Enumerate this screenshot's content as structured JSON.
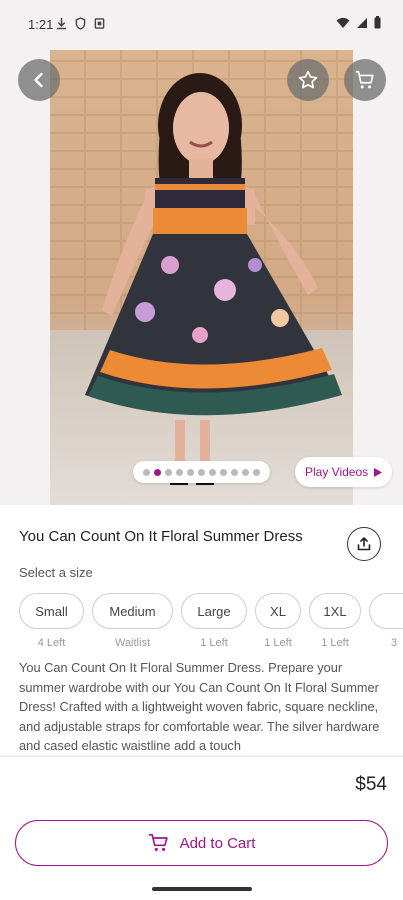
{
  "status_bar": {
    "time": "1:21"
  },
  "product": {
    "title": "You Can Count On It Floral Summer Dress",
    "select_size_label": "Select a size",
    "sizes": [
      {
        "label": "Small",
        "availability": "4 Left"
      },
      {
        "label": "Medium",
        "availability": "Waitlist"
      },
      {
        "label": "Large",
        "availability": "1 Left"
      },
      {
        "label": "XL",
        "availability": "1 Left"
      },
      {
        "label": "1XL",
        "availability": "1 Left"
      },
      {
        "label": "",
        "availability": "3"
      }
    ],
    "description": "You Can Count On It Floral Summer Dress. Prepare your summer wardrobe with our You Can Count On It Floral Summer Dress! Crafted with a lightweight woven fabric, square neckline, and adjustable straps for comfortable wear. The silver hardware and cased elastic waistline add a touch",
    "price": "$54"
  },
  "gallery": {
    "image_count": 11,
    "active_index": 1,
    "play_videos_label": "Play Videos"
  },
  "actions": {
    "add_to_cart_label": "Add to Cart"
  },
  "colors": {
    "accent": "#a0148c"
  },
  "icons": [
    "back-arrow-icon",
    "star-icon",
    "cart-icon",
    "share-icon",
    "play-icon"
  ]
}
